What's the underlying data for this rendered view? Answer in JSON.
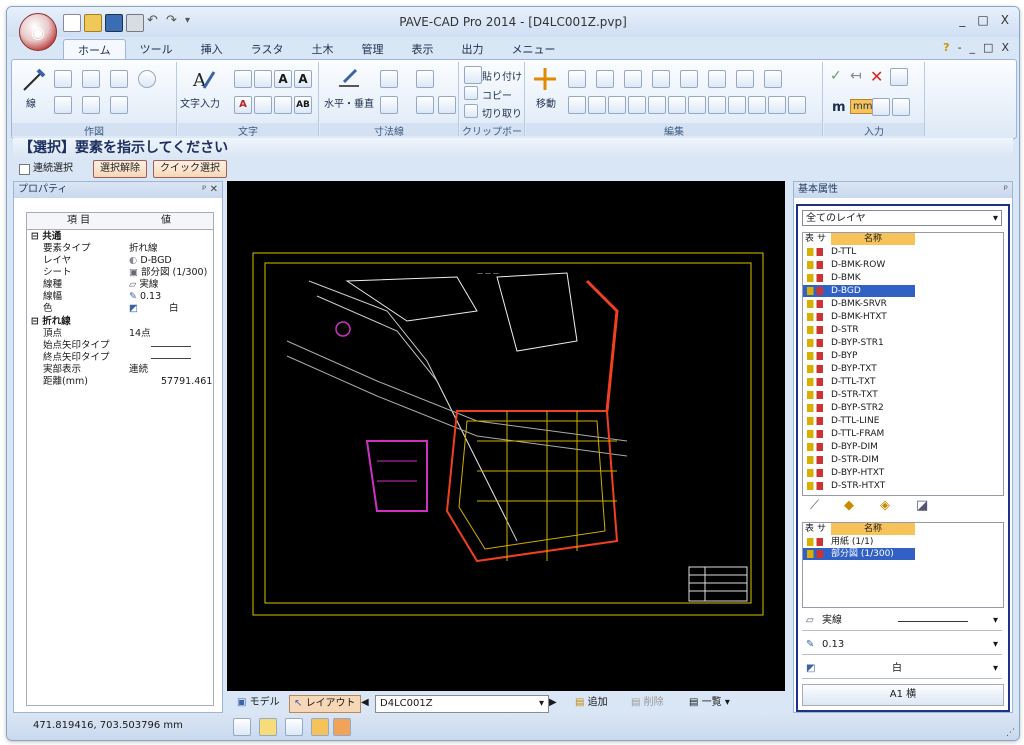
{
  "window": {
    "title": "PAVE-CAD Pro 2014 - [D4LC001Z.pvp]",
    "controls": [
      "_",
      "□",
      "X"
    ],
    "help": [
      "?",
      "-",
      "_",
      "□",
      "X"
    ]
  },
  "ribbon": {
    "tabs": [
      {
        "label": "ホーム",
        "active": true
      },
      {
        "label": "ツール"
      },
      {
        "label": "挿入"
      },
      {
        "label": "ラスタ"
      },
      {
        "label": "土木"
      },
      {
        "label": "管理"
      },
      {
        "label": "表示"
      },
      {
        "label": "出力"
      },
      {
        "label": "メニュー"
      }
    ],
    "groups": {
      "draw": {
        "label": "作図",
        "big_label": "線"
      },
      "text": {
        "label": "文字",
        "big_label": "文字入力"
      },
      "dim": {
        "label": "寸法線",
        "big_label": "水平・垂直"
      },
      "clip": {
        "label": "クリップボード",
        "paste": "貼り付け",
        "copy": "コピー",
        "cut": "切り取り"
      },
      "edit": {
        "label": "編集",
        "big_label": "移動"
      },
      "input": {
        "label": "入力",
        "m": "m",
        "mm": "mm"
      }
    }
  },
  "prompt": {
    "text": "【選択】要素を指示してください"
  },
  "options": {
    "continuous": "連続選択",
    "deselect": "選択解除",
    "quick_select": "クイック選択"
  },
  "property_panel": {
    "title": "プロパティ",
    "col_item": "項 目",
    "col_value": "値",
    "sections": [
      {
        "name": "共通",
        "rows": [
          {
            "key": "要素タイプ",
            "value": "折れ線"
          },
          {
            "key": "レイヤ",
            "value": "D-BGD"
          },
          {
            "key": "シート",
            "value": "部分図 (1/300)"
          },
          {
            "key": "線種",
            "value": "実線"
          },
          {
            "key": "線幅",
            "value": "0.13"
          },
          {
            "key": "色",
            "value": "白"
          }
        ]
      },
      {
        "name": "折れ線",
        "rows": [
          {
            "key": "頂点",
            "value": "14点"
          },
          {
            "key": "始点矢印タイプ",
            "value": ""
          },
          {
            "key": "終点矢印タイプ",
            "value": ""
          },
          {
            "key": "実部表示",
            "value": "連続"
          },
          {
            "key": "距離(mm)",
            "value": "57791.461"
          }
        ]
      }
    ]
  },
  "attr_panel": {
    "title": "基本属性",
    "layer_filter": "全てのレイヤ",
    "table_headers": [
      "表",
      "サ",
      "名称"
    ],
    "layers": [
      "D-TTL",
      "D-BMK-ROW",
      "D-BMK",
      "D-BGD",
      "D-BMK-SRVR",
      "D-BMK-HTXT",
      "D-STR",
      "D-BYP-STR1",
      "D-BYP",
      "D-BYP-TXT",
      "D-TTL-TXT",
      "D-STR-TXT",
      "D-BYP-STR2",
      "D-TTL-LINE",
      "D-TTL-FRAM",
      "D-BYP-DIM",
      "D-STR-DIM",
      "D-BYP-HTXT",
      "D-STR-HTXT"
    ],
    "selected_layer": "D-BGD",
    "sheets": [
      "用紙 (1/1)",
      "部分図 (1/300)"
    ],
    "selected_sheet": "部分図 (1/300)",
    "line_type": "実線",
    "line_width": "0.13",
    "color": "白",
    "paper": "A1 横"
  },
  "bottom_bar": {
    "model": "モデル",
    "layout": "レイアウト",
    "sheet_select": "D4LC001Z",
    "add": "追加",
    "delete": "削除",
    "list": "一覧"
  },
  "status": {
    "coords": "471.819416, 703.503796 mm"
  }
}
